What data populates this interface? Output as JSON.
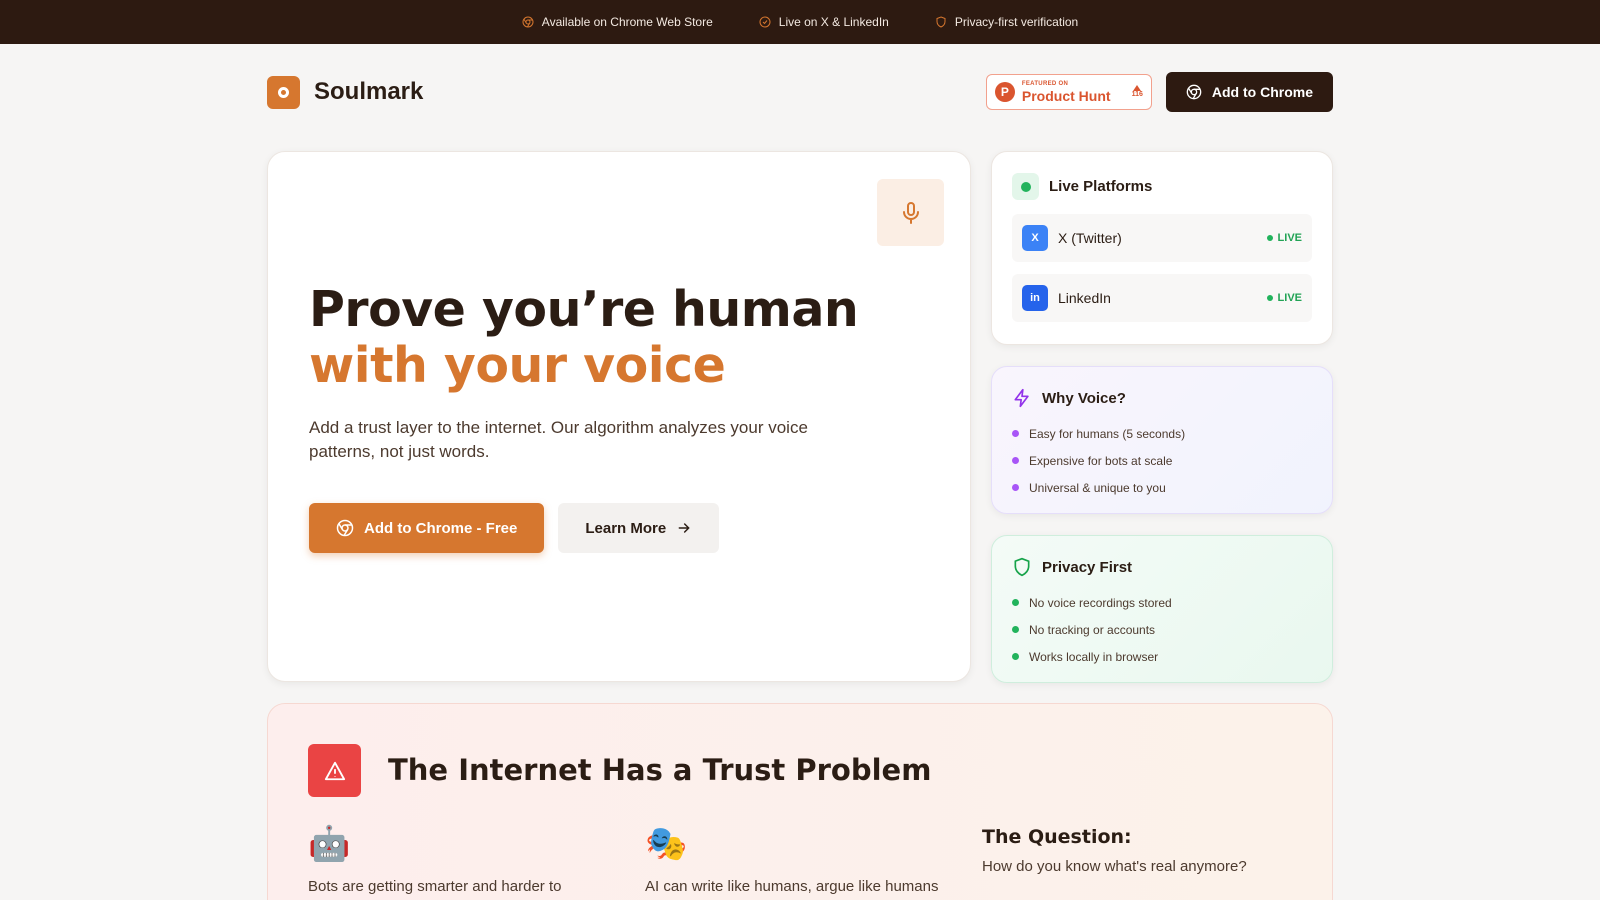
{
  "topbar": {
    "items": [
      {
        "label": "Available on Chrome Web Store",
        "icon": "chrome-icon"
      },
      {
        "label": "Live on X & LinkedIn",
        "icon": "check-circle-icon"
      },
      {
        "label": "Privacy-first verification",
        "icon": "shield-icon"
      }
    ]
  },
  "header": {
    "brand": "Soulmark",
    "product_hunt": {
      "featured": "FEATURED ON",
      "name": "Product Hunt",
      "votes": "116"
    },
    "cta": "Add to Chrome"
  },
  "hero": {
    "title_line1": "Prove you’re human",
    "title_line2": "with your voice",
    "lead": "Add a trust layer to the internet. Our algorithm analyzes your voice patterns, not just words.",
    "primary_cta": "Add to Chrome - Free",
    "secondary_cta": "Learn More"
  },
  "live_platforms": {
    "title": "Live Platforms",
    "platforms": [
      {
        "name": "X (Twitter)",
        "status": "LIVE",
        "icon": "x-icon"
      },
      {
        "name": "LinkedIn",
        "status": "LIVE",
        "icon": "linkedin-icon"
      }
    ]
  },
  "why_voice": {
    "title": "Why Voice?",
    "items": [
      "Easy for humans (5 seconds)",
      "Expensive for bots at scale",
      "Universal & unique to you"
    ]
  },
  "privacy": {
    "title": "Privacy First",
    "items": [
      "No voice recordings stored",
      "No tracking or accounts",
      "Works locally in browser"
    ]
  },
  "trust": {
    "title": "The Internet Has a Trust Problem",
    "col1": {
      "emoji": "🤖",
      "text": "Bots are getting smarter and harder to"
    },
    "col2": {
      "emoji": "🎭",
      "text": "AI can write like humans, argue like humans"
    },
    "col3": {
      "title": "The Question:",
      "text": "How do you know what's real anymore?"
    }
  },
  "colors": {
    "accent": "#d6772f",
    "dark": "#2d1a11",
    "live": "#22b35c",
    "warn": "#ea4444"
  }
}
